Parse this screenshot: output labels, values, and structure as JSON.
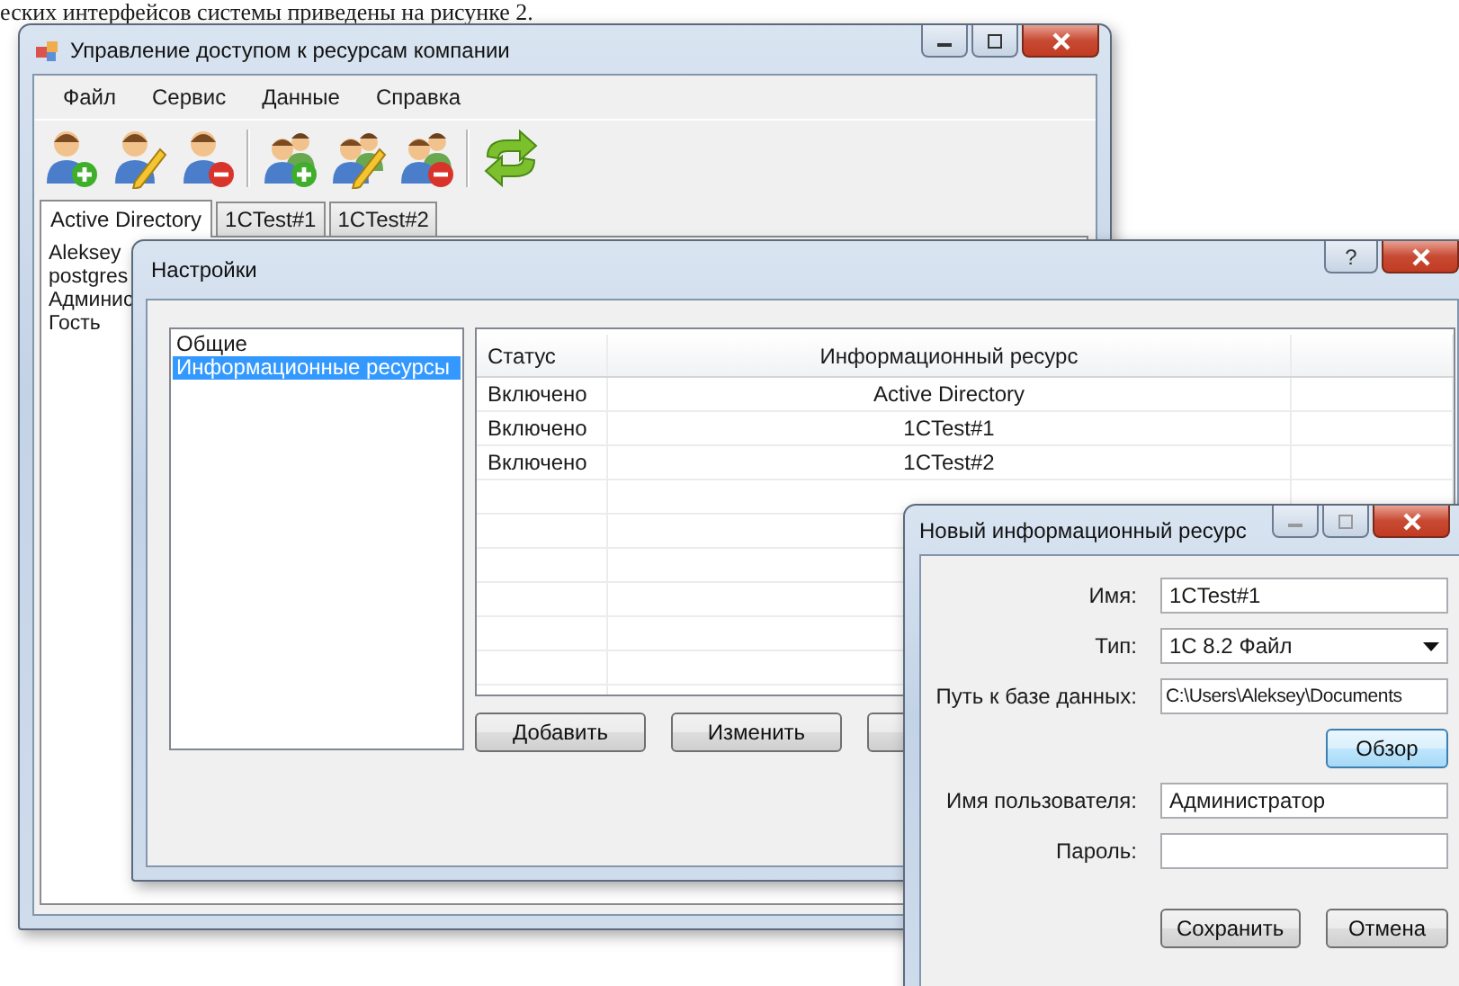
{
  "caption": "еских интерфейсов системы приведены на рисунке 2.",
  "main_window": {
    "title": "Управление доступом к ресурсам компании",
    "menu": [
      "Файл",
      "Сервис",
      "Данные",
      "Справка"
    ],
    "toolbar": [
      {
        "kind": "user_add"
      },
      {
        "kind": "user_edit"
      },
      {
        "kind": "user_remove"
      },
      {
        "kind": "group_add"
      },
      {
        "kind": "group_edit"
      },
      {
        "kind": "group_remove"
      },
      {
        "kind": "refresh"
      }
    ],
    "tabs": [
      {
        "label": "Active Directory",
        "selected": true
      },
      {
        "label": "1CTest#1",
        "selected": false
      },
      {
        "label": "1CTest#2",
        "selected": false
      }
    ],
    "users": [
      "Aleksey",
      "postgres",
      "Админис",
      "Гость"
    ]
  },
  "settings_dialog": {
    "title": "Настройки",
    "help_button": "?",
    "sections": [
      {
        "label": "Общие",
        "selected": false
      },
      {
        "label": "Информационные ресурсы",
        "selected": true
      }
    ],
    "columns": [
      "Статус",
      "Информационный ресурс"
    ],
    "rows": [
      {
        "status": "Включено",
        "resource": "Active Directory"
      },
      {
        "status": "Включено",
        "resource": "1CTest#1"
      },
      {
        "status": "Включено",
        "resource": "1CTest#2"
      }
    ],
    "buttons": [
      "Добавить",
      "Изменить"
    ]
  },
  "resource_dialog": {
    "title": "Новый информационный ресурс",
    "fields": [
      {
        "label": "Имя:",
        "kind": "text",
        "value": "1CTest#1"
      },
      {
        "label": "Тип:",
        "kind": "combo",
        "value": "1С 8.2 Файл"
      },
      {
        "label": "Путь к базе данных:",
        "kind": "path",
        "value": "C:\\Users\\Aleksey\\Documents"
      },
      {
        "label": "Имя пользователя:",
        "kind": "text",
        "value": "Администратор"
      },
      {
        "label": "Пароль:",
        "kind": "password"
      }
    ],
    "browse_button": "Обзор",
    "buttons": [
      "Сохранить",
      "Отмена"
    ]
  }
}
